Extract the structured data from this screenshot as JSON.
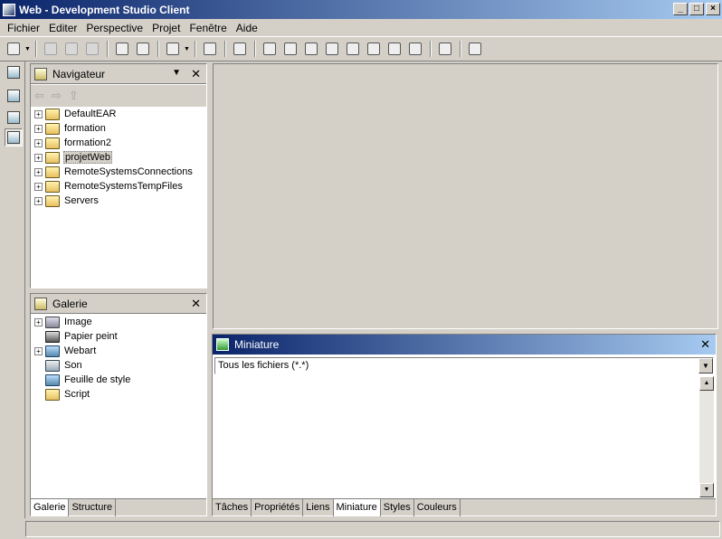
{
  "window": {
    "title": "Web - Development Studio Client"
  },
  "menu": [
    "Fichier",
    "Editer",
    "Perspective",
    "Projet",
    "Fenêtre",
    "Aide"
  ],
  "navigator": {
    "title": "Navigateur",
    "items": [
      {
        "label": "DefaultEAR",
        "icon": "ear-project-icon",
        "selected": false
      },
      {
        "label": "formation",
        "icon": "java-project-icon",
        "selected": false
      },
      {
        "label": "formation2",
        "icon": "web-project-icon",
        "selected": false
      },
      {
        "label": "projetWeb",
        "icon": "web-project-icon",
        "selected": true
      },
      {
        "label": "RemoteSystemsConnections",
        "icon": "project-folder-icon",
        "selected": false
      },
      {
        "label": "RemoteSystemsTempFiles",
        "icon": "project-folder-icon",
        "selected": false
      },
      {
        "label": "Servers",
        "icon": "server-project-icon",
        "selected": false
      }
    ]
  },
  "gallery": {
    "title": "Galerie",
    "items": [
      {
        "label": "Image",
        "icon": "image-icon",
        "expandable": true
      },
      {
        "label": "Papier peint",
        "icon": "wallpaper-icon",
        "expandable": false
      },
      {
        "label": "Webart",
        "icon": "webart-icon",
        "expandable": true
      },
      {
        "label": "Son",
        "icon": "sound-icon",
        "expandable": false
      },
      {
        "label": "Feuille de style",
        "icon": "stylesheet-icon",
        "expandable": false
      },
      {
        "label": "Script",
        "icon": "script-icon",
        "expandable": false
      }
    ],
    "tabs": [
      "Galerie",
      "Structure"
    ]
  },
  "miniature": {
    "title": "Miniature",
    "filter": "Tous les fichiers (*.*)",
    "tabs": [
      "Tâches",
      "Propriétés",
      "Liens",
      "Miniature",
      "Styles",
      "Couleurs"
    ],
    "active_tab": "Miniature"
  },
  "colors": {
    "titlebar_start": "#0a246a",
    "titlebar_end": "#a6caf0",
    "face": "#d4d0c8"
  }
}
